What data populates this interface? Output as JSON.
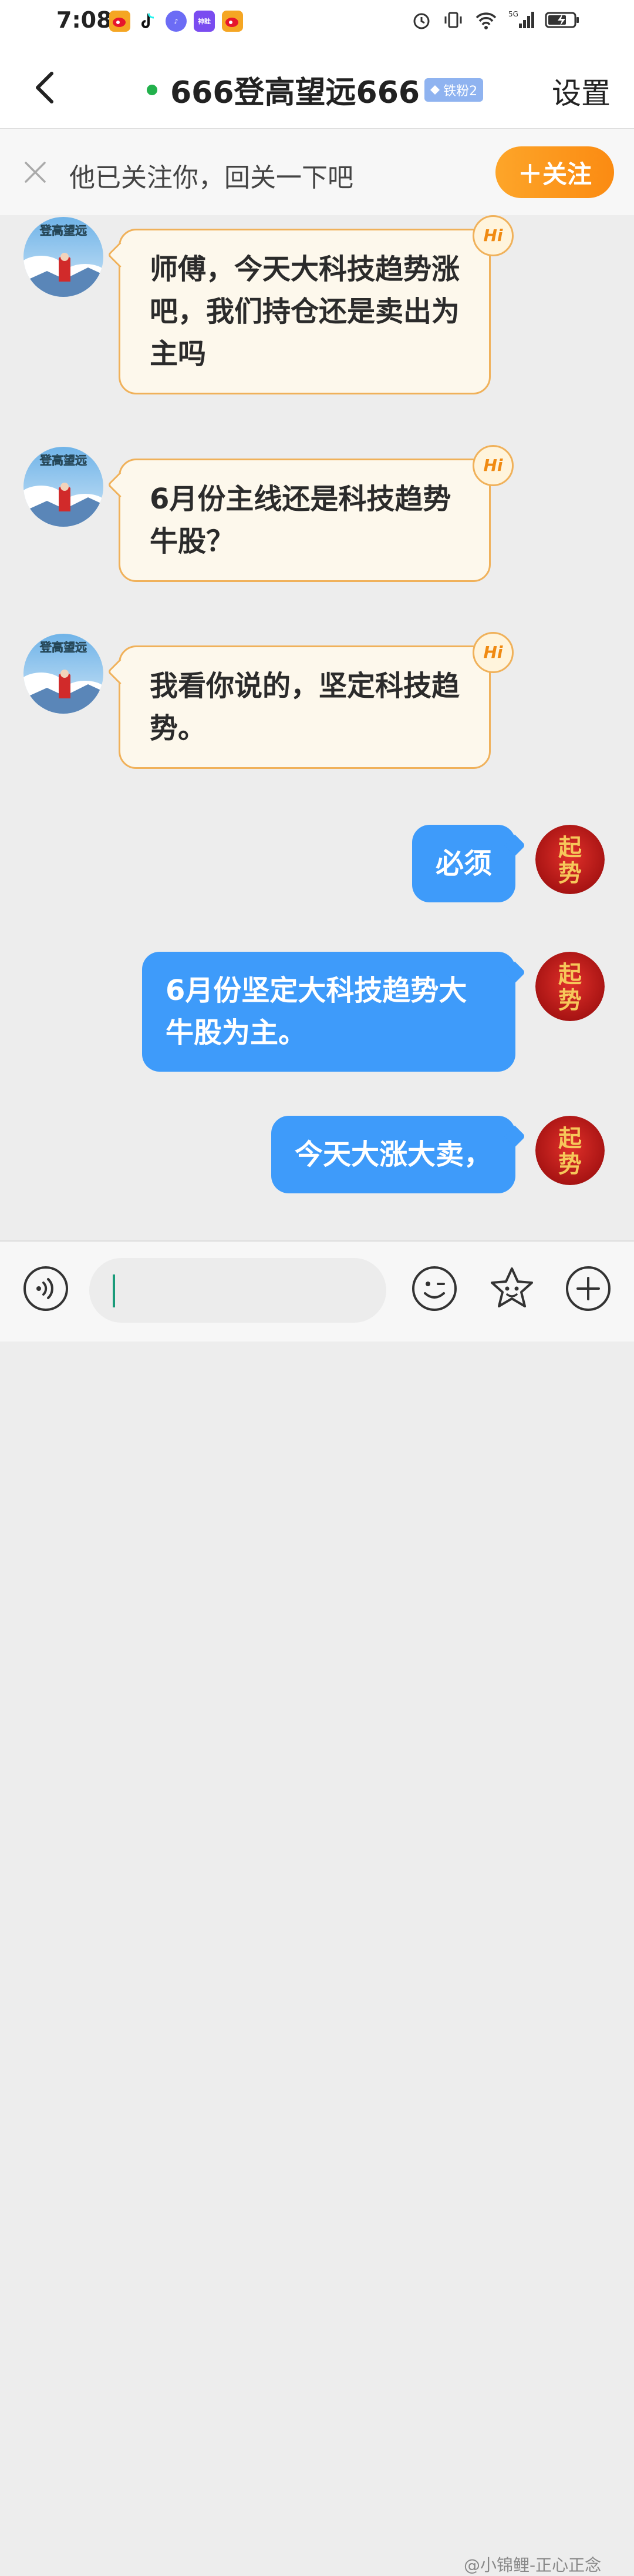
{
  "status_bar": {
    "time": "7:08",
    "app_badge_label": "神眭",
    "network": "5G"
  },
  "header": {
    "title": "666登高望远666",
    "fan_badge": "铁粉2",
    "settings_label": "设置",
    "online_color": "#22b14c"
  },
  "follow_prompt": {
    "text": "他已关注你，回关一下吧",
    "button_label": "＋关注"
  },
  "messages": [
    {
      "direction": "incoming",
      "avatar_text": "登高望远",
      "badge": "Hi",
      "text": "师傅，今天大科技趋势涨吧，我们持仓还是卖出为主吗"
    },
    {
      "direction": "incoming",
      "avatar_text": "登高望远",
      "badge": "Hi",
      "text": "6月份主线还是科技趋势牛股？"
    },
    {
      "direction": "incoming",
      "avatar_text": "登高望远",
      "badge": "Hi",
      "text": "我看你说的，坚定科技趋势。"
    },
    {
      "direction": "outgoing",
      "avatar_text": "起势",
      "text": "必须"
    },
    {
      "direction": "outgoing",
      "avatar_text": "起势",
      "text": "6月份坚定大科技趋势大牛股为主。"
    },
    {
      "direction": "outgoing",
      "avatar_text": "起势",
      "text": "今天大涨大卖，"
    }
  ],
  "input_bar": {
    "placeholder": "",
    "icons": [
      "voice-icon",
      "emoji-icon",
      "sticker-icon",
      "plus-icon"
    ]
  },
  "watermark": "@小锦鲤-正心正念",
  "colors": {
    "outgoing_bubble": "#3e9bfa",
    "incoming_bubble": "#fdf8ec",
    "incoming_border": "#f0b15a",
    "follow_button": "#fb8b12"
  }
}
